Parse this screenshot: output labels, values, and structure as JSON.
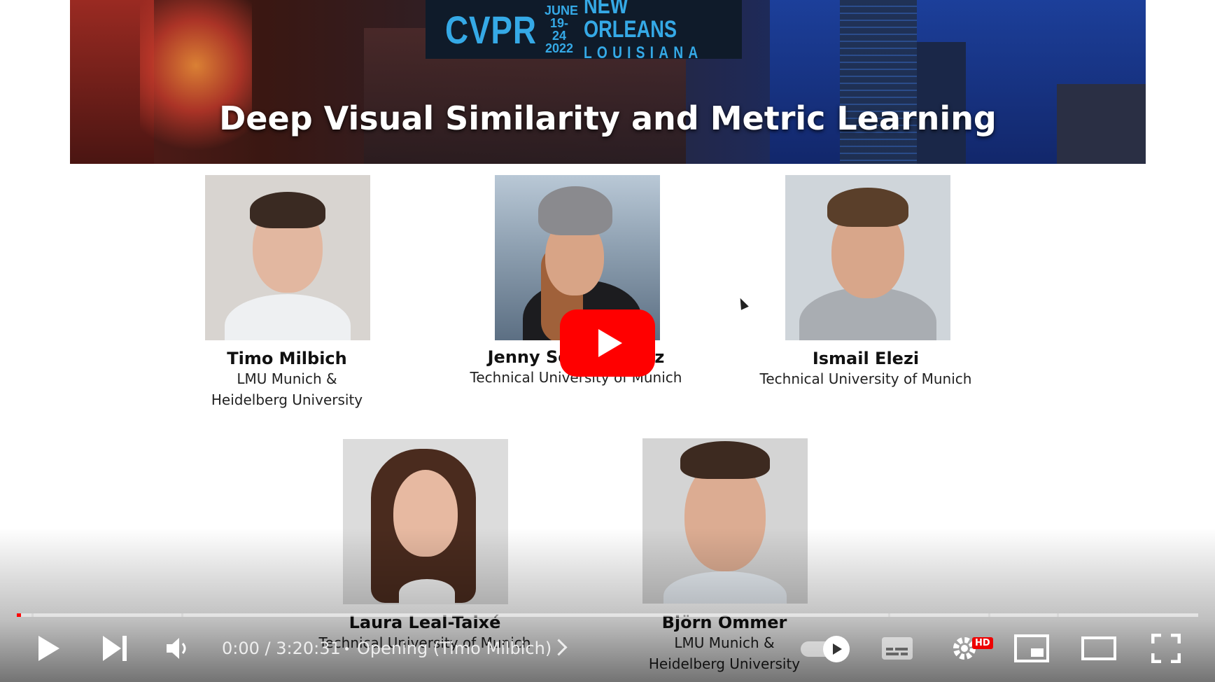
{
  "banner": {
    "title": "Deep Visual Similarity and Metric Learning",
    "logo_text": "CVPR",
    "logo_date_month": "JUNE",
    "logo_date_days": "19-24",
    "logo_date_year": "2022",
    "logo_city": "NEW ORLEANS",
    "logo_state": "LOUISIANA",
    "accent": "#35a9e6"
  },
  "speakers": [
    {
      "name": "Timo Milbich",
      "affil1": "LMU Munich &",
      "affil2": "Heidelberg University"
    },
    {
      "name": "Jenny Se",
      "name_tail": "rz",
      "affil1": "Technical University of Munich",
      "affil2": ""
    },
    {
      "name": "Ismail Elezi",
      "affil1": "Technical University of Munich",
      "affil2": ""
    },
    {
      "name": "Laura Leal-Taixé",
      "affil1": "Technical University of Munich",
      "affil2": ""
    },
    {
      "name": "Björn Ommer",
      "affil1": "LMU Munich &",
      "affil2": "Heidelberg University"
    }
  ],
  "player": {
    "time": "0:00 / 3:20:31",
    "chapter": "Opening (Timo Milbich)",
    "quality_badge": "HD",
    "play_color": "#ff0000",
    "progress": 0.002
  },
  "icons": {
    "play": "play-icon",
    "next": "next-icon",
    "volume": "volume-icon",
    "autoplay": "autoplay-toggle",
    "subtitles": "subtitles-icon",
    "settings": "gear-icon",
    "miniplayer": "miniplayer-icon",
    "theater": "theater-icon",
    "fullscreen": "fullscreen-icon"
  }
}
